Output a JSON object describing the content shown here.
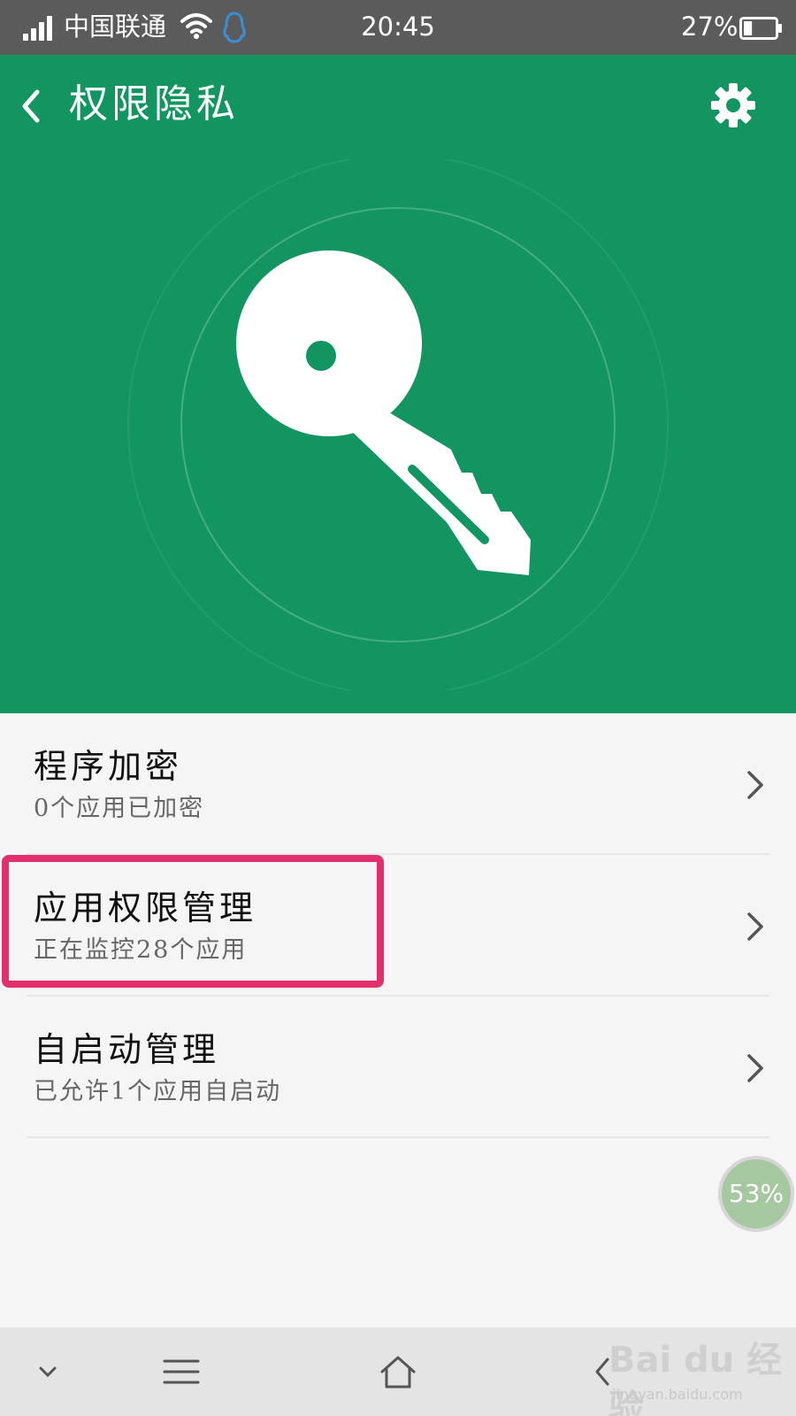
{
  "status_bar": {
    "carrier": "中国联通",
    "time": "20:45",
    "battery": "27%",
    "battery_level": 0.27
  },
  "header": {
    "title": "权限隐私",
    "back_icon": "chevron-left-icon",
    "settings_icon": "gear-icon",
    "hero_icon": "key-icon",
    "background_color": "#139561"
  },
  "list": {
    "items": [
      {
        "title": "程序加密",
        "subtitle": "0个应用已加密"
      },
      {
        "title": "应用权限管理",
        "subtitle": "正在监控28个应用",
        "highlighted": true
      },
      {
        "title": "自启动管理",
        "subtitle": "已允许1个应用自启动"
      }
    ]
  },
  "float_badge": {
    "text": "53%"
  },
  "nav_bar": {
    "icons": [
      "chevron-down-icon",
      "menu-icon",
      "home-icon",
      "back-icon"
    ]
  },
  "watermark": {
    "logo": "Bai du 经验",
    "url": "jingyan.baidu.com"
  },
  "colors": {
    "accent": "#139561",
    "highlight_border": "#e2306f",
    "status_bar": "#5b5b5b"
  }
}
